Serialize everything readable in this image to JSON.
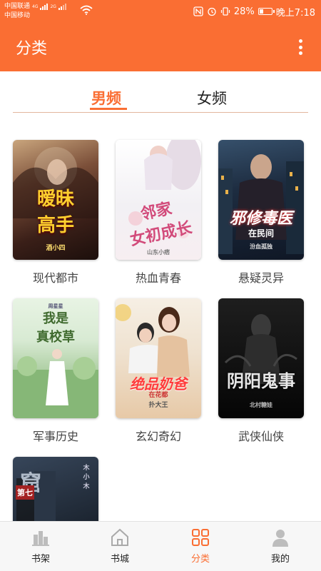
{
  "status_bar": {
    "carrier1": "中国联通",
    "carrier1_net": "4G",
    "carrier2": "中国移动",
    "carrier2_net": "2G",
    "battery": "28%",
    "time": "晚上7:18"
  },
  "header": {
    "title": "分类"
  },
  "tabs": [
    {
      "label": "男频",
      "active": true
    },
    {
      "label": "女频",
      "active": false
    }
  ],
  "categories": [
    {
      "label": "现代都市",
      "cover_title": "暧昧高手",
      "cover_author": "酒小四"
    },
    {
      "label": "热血青春",
      "cover_title": "邻家女初长成",
      "cover_author": "山东小痞"
    },
    {
      "label": "悬疑灵异",
      "cover_title": "邪修毒医在民间",
      "cover_author": "汾血孤独"
    },
    {
      "label": "军事历史",
      "cover_title": "我是真校草",
      "cover_author": "周星星"
    },
    {
      "label": "玄幻奇幻",
      "cover_title": "绝品奶爸在花都",
      "cover_author": "扑大王"
    },
    {
      "label": "武侠仙侠",
      "cover_title": "阴阳鬼事",
      "cover_author": "北村糖娃"
    },
    {
      "label": "",
      "cover_title": "第七窟",
      "cover_author": "木小木"
    }
  ],
  "bottom_nav": [
    {
      "label": "书架",
      "icon": "bookshelf-icon",
      "active": false
    },
    {
      "label": "书城",
      "icon": "home-icon",
      "active": false
    },
    {
      "label": "分类",
      "icon": "grid-icon",
      "active": true
    },
    {
      "label": "我的",
      "icon": "person-icon",
      "active": false
    }
  ],
  "colors": {
    "accent": "#fa6e33",
    "text": "#444444",
    "nav_bg": "#f7f7f7"
  }
}
